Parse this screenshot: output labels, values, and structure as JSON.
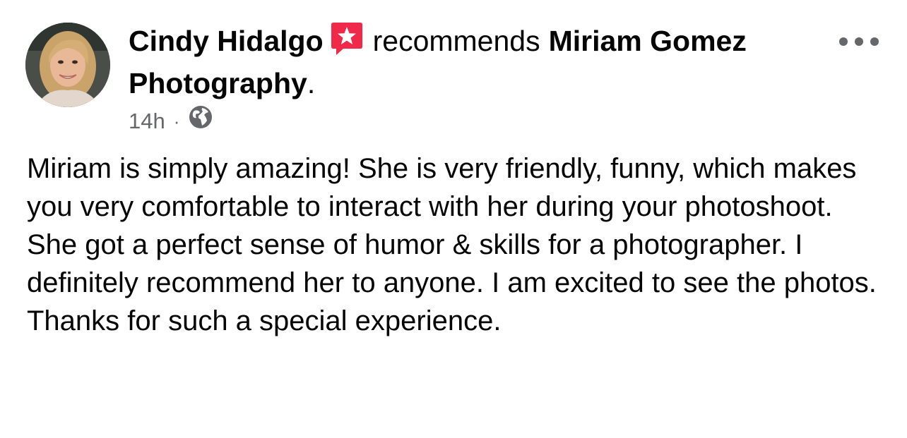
{
  "post": {
    "author_name": "Cindy Hidalgo",
    "recommends_word": "recommends",
    "page_name_line1": "Miriam Gomez",
    "page_name_line2": "Photography",
    "period": ".",
    "timestamp": "14h",
    "separator": "·",
    "privacy_icon": "globe-icon",
    "more_icon": "more-options-icon",
    "badge_icon": "recommendation-star-icon",
    "badge_color": "#f02849",
    "paragraphs": [
      "Miriam is simply amazing! She is very friendly, funny, which makes you very comfortable to interact with her during your photoshoot.",
      "She got a perfect sense of humor & skills for a photographer. I definitely recommend her to anyone. I am excited to see the photos. Thanks for such a special experience."
    ]
  }
}
